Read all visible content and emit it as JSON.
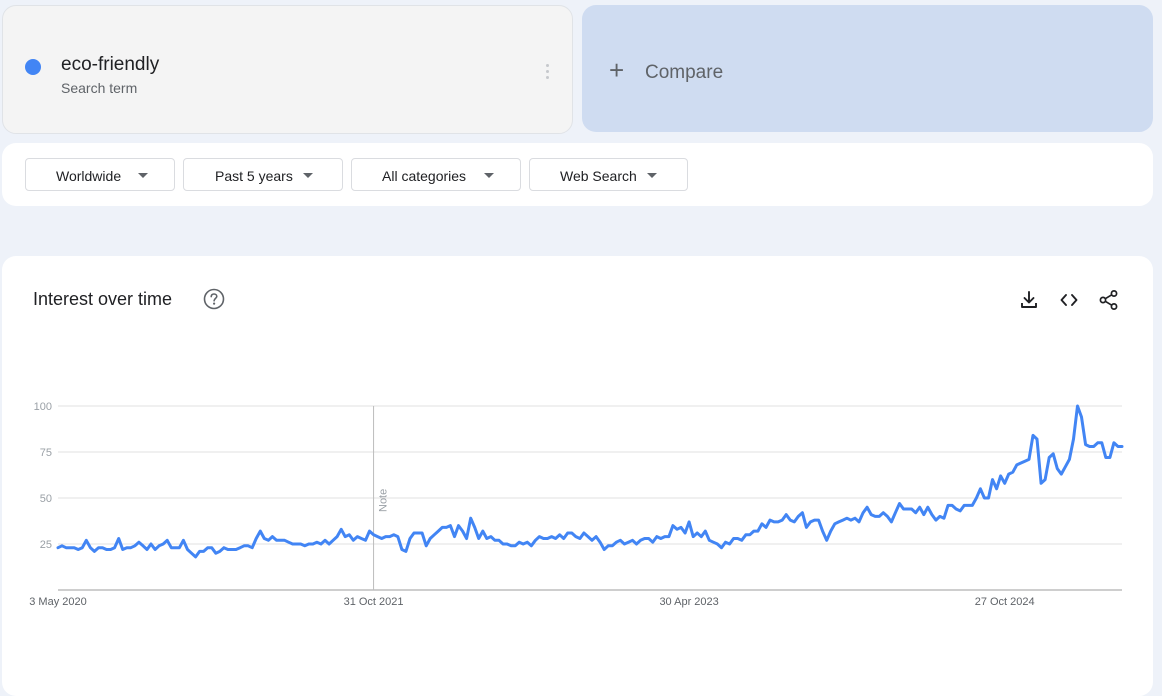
{
  "term": {
    "name": "eco-friendly",
    "type": "Search term",
    "color": "#4285f4"
  },
  "compare": {
    "label": "Compare",
    "icon": "plus-icon"
  },
  "filters": [
    {
      "label": "Worldwide"
    },
    {
      "label": "Past 5 years"
    },
    {
      "label": "All categories"
    },
    {
      "label": "Web Search"
    }
  ],
  "chart": {
    "title": "Interest over time",
    "icons": [
      "help-icon",
      "download-icon",
      "embed-icon",
      "share-icon"
    ]
  },
  "chart_data": {
    "type": "line",
    "title": "Interest over time",
    "xlabel": "",
    "ylabel": "",
    "ylim": [
      0,
      100
    ],
    "yticks": [
      25,
      50,
      75,
      100
    ],
    "xtick_labels": [
      "3 May 2020",
      "31 Oct 2021",
      "30 Apr 2023",
      "27 Oct 2024"
    ],
    "grid": true,
    "note": {
      "label": "Note",
      "x": "31 Oct 2021"
    },
    "series": [
      {
        "color": "#4285f4",
        "start": "3 May 2020",
        "interval": "week",
        "values": [
          23,
          24,
          23,
          23,
          23,
          22,
          23,
          27,
          23,
          21,
          23,
          23,
          22,
          22,
          23,
          28,
          22,
          23,
          23,
          24,
          26,
          24,
          22,
          25,
          22,
          24,
          25,
          27,
          23,
          23,
          23,
          27,
          22,
          20,
          18,
          21,
          21,
          23,
          23,
          20,
          21,
          23,
          22,
          22,
          22,
          23,
          24,
          24,
          23,
          28,
          32,
          28,
          27,
          29,
          27,
          27,
          27,
          26,
          25,
          25,
          25,
          24,
          25,
          25,
          26,
          25,
          27,
          25,
          27,
          29,
          33,
          29,
          30,
          27,
          29,
          28,
          27,
          32,
          30,
          29,
          28,
          29,
          29,
          30,
          29,
          22,
          21,
          28,
          31,
          31,
          31,
          24,
          28,
          30,
          32,
          34,
          34,
          35,
          29,
          35,
          32,
          28,
          39,
          34,
          28,
          32,
          28,
          29,
          27,
          27,
          25,
          25,
          24,
          24,
          26,
          25,
          26,
          24,
          27,
          29,
          28,
          28,
          29,
          28,
          30,
          28,
          31,
          31,
          29,
          28,
          31,
          29,
          27,
          29,
          26,
          22,
          24,
          24,
          26,
          27,
          25,
          26,
          27,
          25,
          27,
          28,
          28,
          26,
          29,
          28,
          29,
          29,
          35,
          33,
          34,
          31,
          37,
          29,
          31,
          29,
          32,
          27,
          26,
          25,
          23,
          26,
          25,
          28,
          28,
          27,
          30,
          30,
          32,
          32,
          36,
          34,
          38,
          37,
          37,
          38,
          41,
          38,
          37,
          40,
          42,
          34,
          37,
          38,
          38,
          32,
          27,
          32,
          36,
          37,
          38,
          39,
          38,
          39,
          37,
          42,
          45,
          41,
          40,
          40,
          42,
          40,
          37,
          42,
          47,
          44,
          44,
          44,
          42,
          45,
          41,
          45,
          41,
          38,
          40,
          39,
          46,
          46,
          44,
          43,
          46,
          46,
          46,
          50,
          55,
          50,
          50,
          60,
          55,
          62,
          58,
          63,
          64,
          68,
          69,
          70,
          71,
          84,
          82,
          58,
          60,
          72,
          74,
          66,
          63,
          67,
          71,
          82,
          100,
          94,
          79,
          78,
          78,
          80,
          80,
          72,
          72,
          80,
          78,
          78
        ]
      }
    ]
  }
}
